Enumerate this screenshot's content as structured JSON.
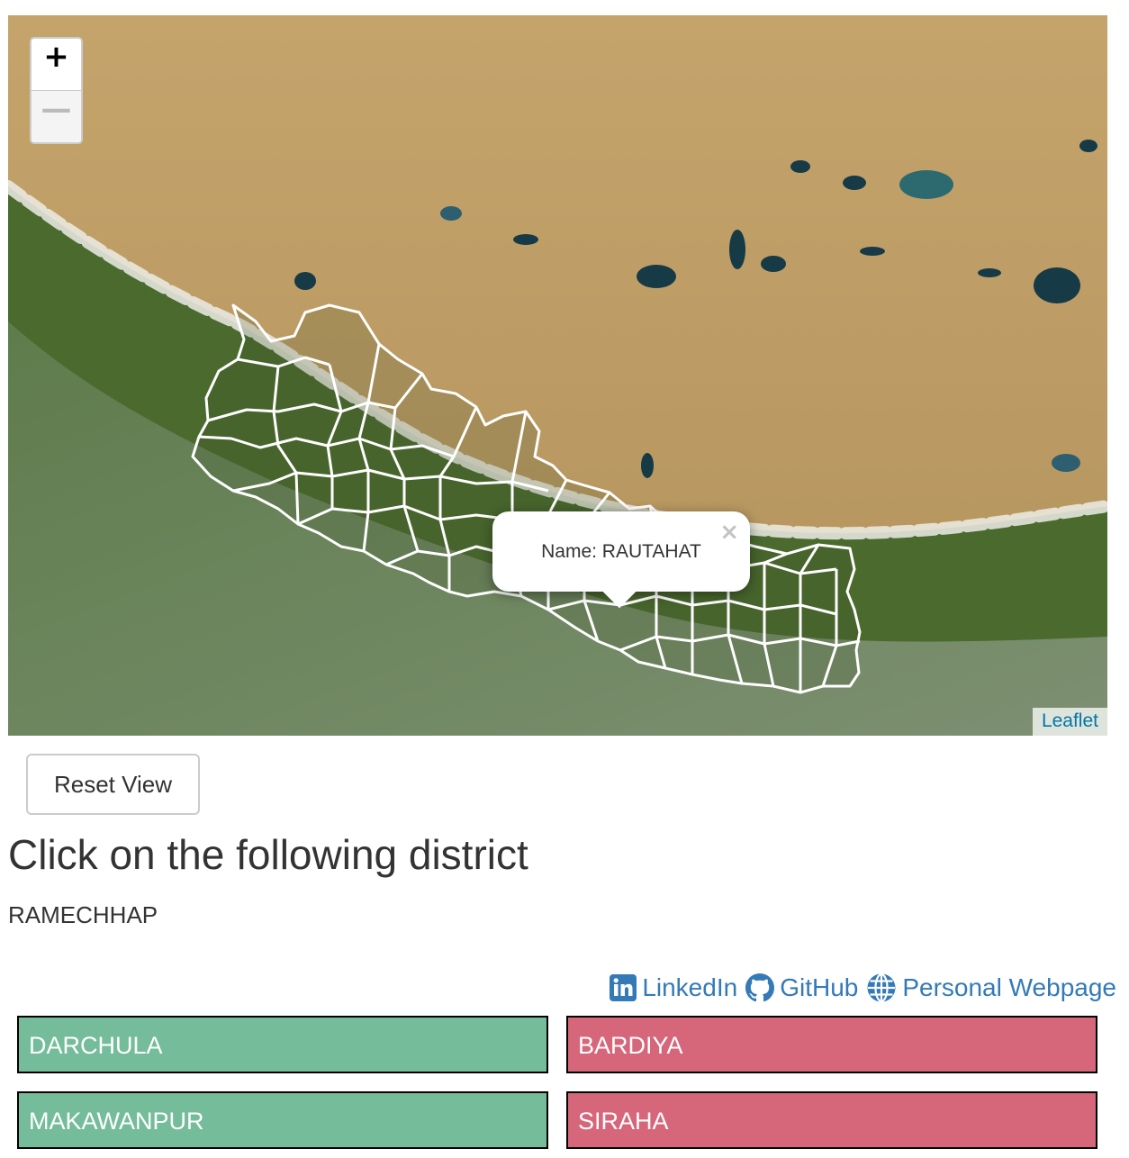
{
  "map": {
    "zoom_in_label": "+",
    "zoom_out_label": "—",
    "popup": {
      "text": "Name: RAUTAHAT",
      "close_label": "×"
    },
    "attribution": "Leaflet",
    "boundary_color": "#ffffff"
  },
  "reset_button": "Reset View",
  "heading": "Click on the following district",
  "target_district": "RAMECHHAP",
  "links": {
    "linkedin": {
      "label": "LinkedIn",
      "icon": "linkedin-icon"
    },
    "github": {
      "label": "GitHub",
      "icon": "github-icon"
    },
    "webpage": {
      "label": "Personal Webpage",
      "icon": "globe-icon"
    },
    "color": "#337ab7"
  },
  "choices": [
    {
      "label": "DARCHULA",
      "color": "#75bc9a"
    },
    {
      "label": "BARDIYA",
      "color": "#d6667a"
    },
    {
      "label": "MAKAWANPUR",
      "color": "#75bc9a"
    },
    {
      "label": "SIRAHA",
      "color": "#d6667a"
    }
  ]
}
